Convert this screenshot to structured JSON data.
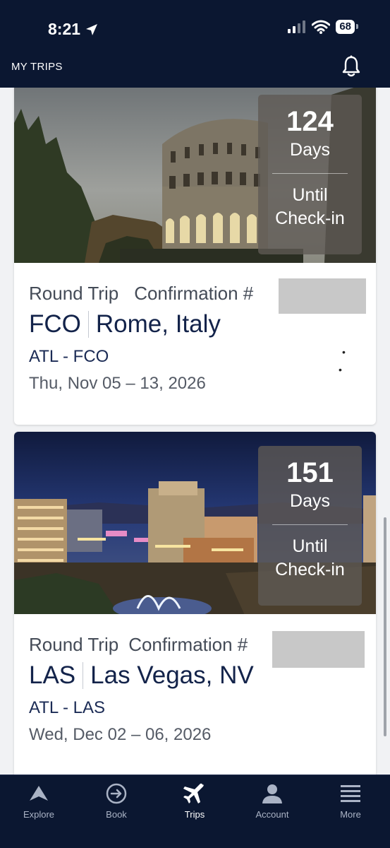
{
  "status": {
    "time": "8:21",
    "battery": "68"
  },
  "header": {
    "title": "MY TRIPS"
  },
  "trips": [
    {
      "countdown_value": "124",
      "countdown_unit": "Days",
      "countdown_label_line1": "Until",
      "countdown_label_line2": "Check-in",
      "trip_type": "Round Trip",
      "confirmation_label": "Confirmation #",
      "airport_code": "FCO",
      "city": "Rome, Italy",
      "route": "ATL - FCO",
      "dates": "Thu, Nov 05 – 13, 2026"
    },
    {
      "countdown_value": "151",
      "countdown_unit": "Days",
      "countdown_label_line1": "Until",
      "countdown_label_line2": "Check-in",
      "trip_type": "Round Trip",
      "confirmation_label": "Confirmation #",
      "airport_code": "LAS",
      "city": "Las Vegas, NV",
      "route": "ATL - LAS",
      "dates": "Wed, Dec 02 – 06, 2026"
    }
  ],
  "tabs": [
    {
      "label": "Explore",
      "icon": "explore-icon"
    },
    {
      "label": "Book",
      "icon": "book-icon"
    },
    {
      "label": "Trips",
      "icon": "plane-icon",
      "active": true
    },
    {
      "label": "Account",
      "icon": "account-icon"
    },
    {
      "label": "More",
      "icon": "menu-icon"
    }
  ],
  "colors": {
    "navy": "#0b1731",
    "accent_text": "#13234a",
    "card_bg": "#ffffff",
    "page_bg": "#f1f2f4"
  }
}
